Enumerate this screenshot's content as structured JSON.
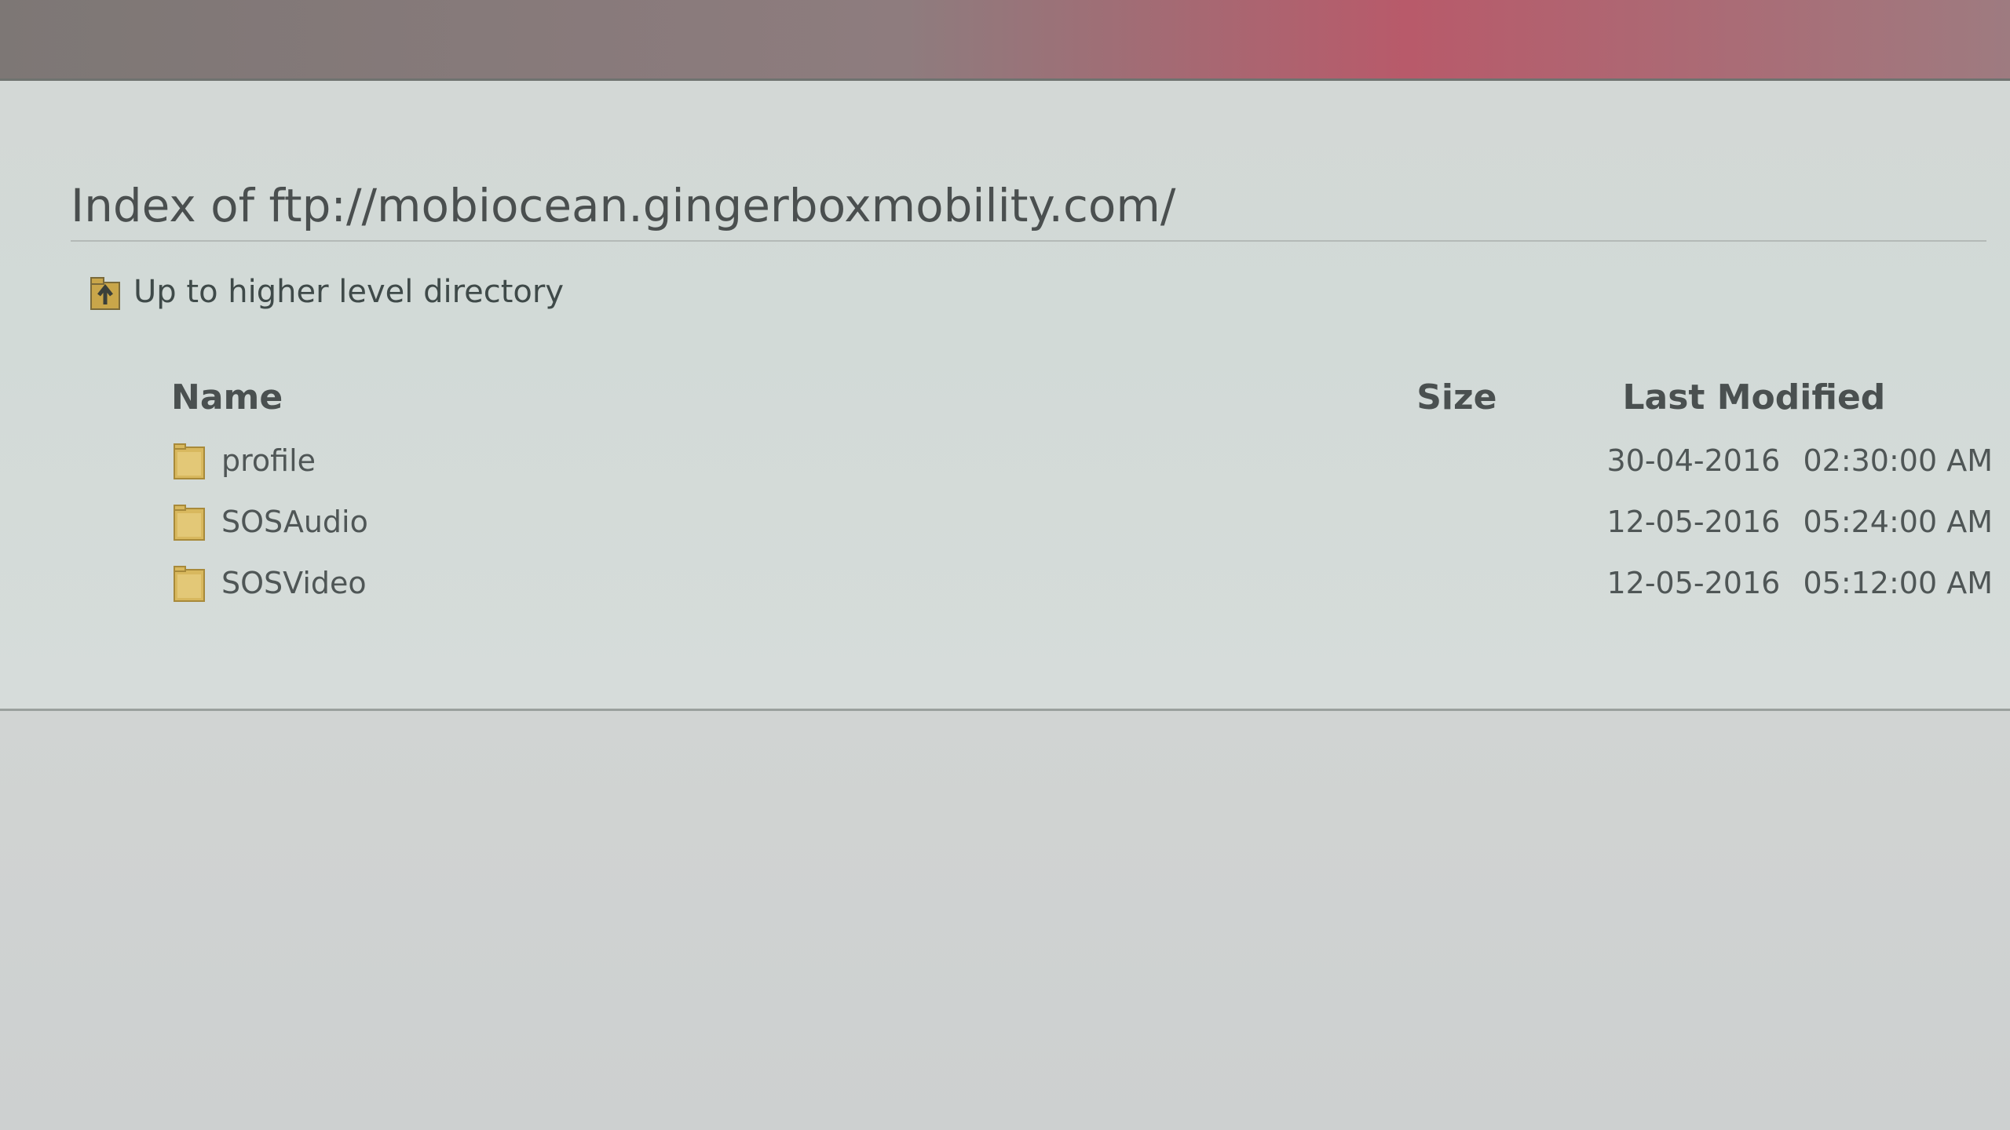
{
  "page": {
    "title": "Index of ftp://mobiocean.gingerboxmobility.com/",
    "up_link_label": "Up to higher level directory"
  },
  "table": {
    "headers": {
      "name": "Name",
      "size": "Size",
      "last_modified": "Last Modified"
    },
    "rows": [
      {
        "name": "profile",
        "size": "",
        "date": "30-04-2016",
        "time": "02:30:00 AM",
        "icon": "folder-icon"
      },
      {
        "name": "SOSAudio",
        "size": "",
        "date": "12-05-2016",
        "time": "05:24:00 AM",
        "icon": "folder-icon"
      },
      {
        "name": "SOSVideo",
        "size": "",
        "date": "12-05-2016",
        "time": "05:12:00 AM",
        "icon": "folder-icon"
      }
    ]
  },
  "colors": {
    "text": "#4a4f4f",
    "folder": "#d8b85e"
  }
}
